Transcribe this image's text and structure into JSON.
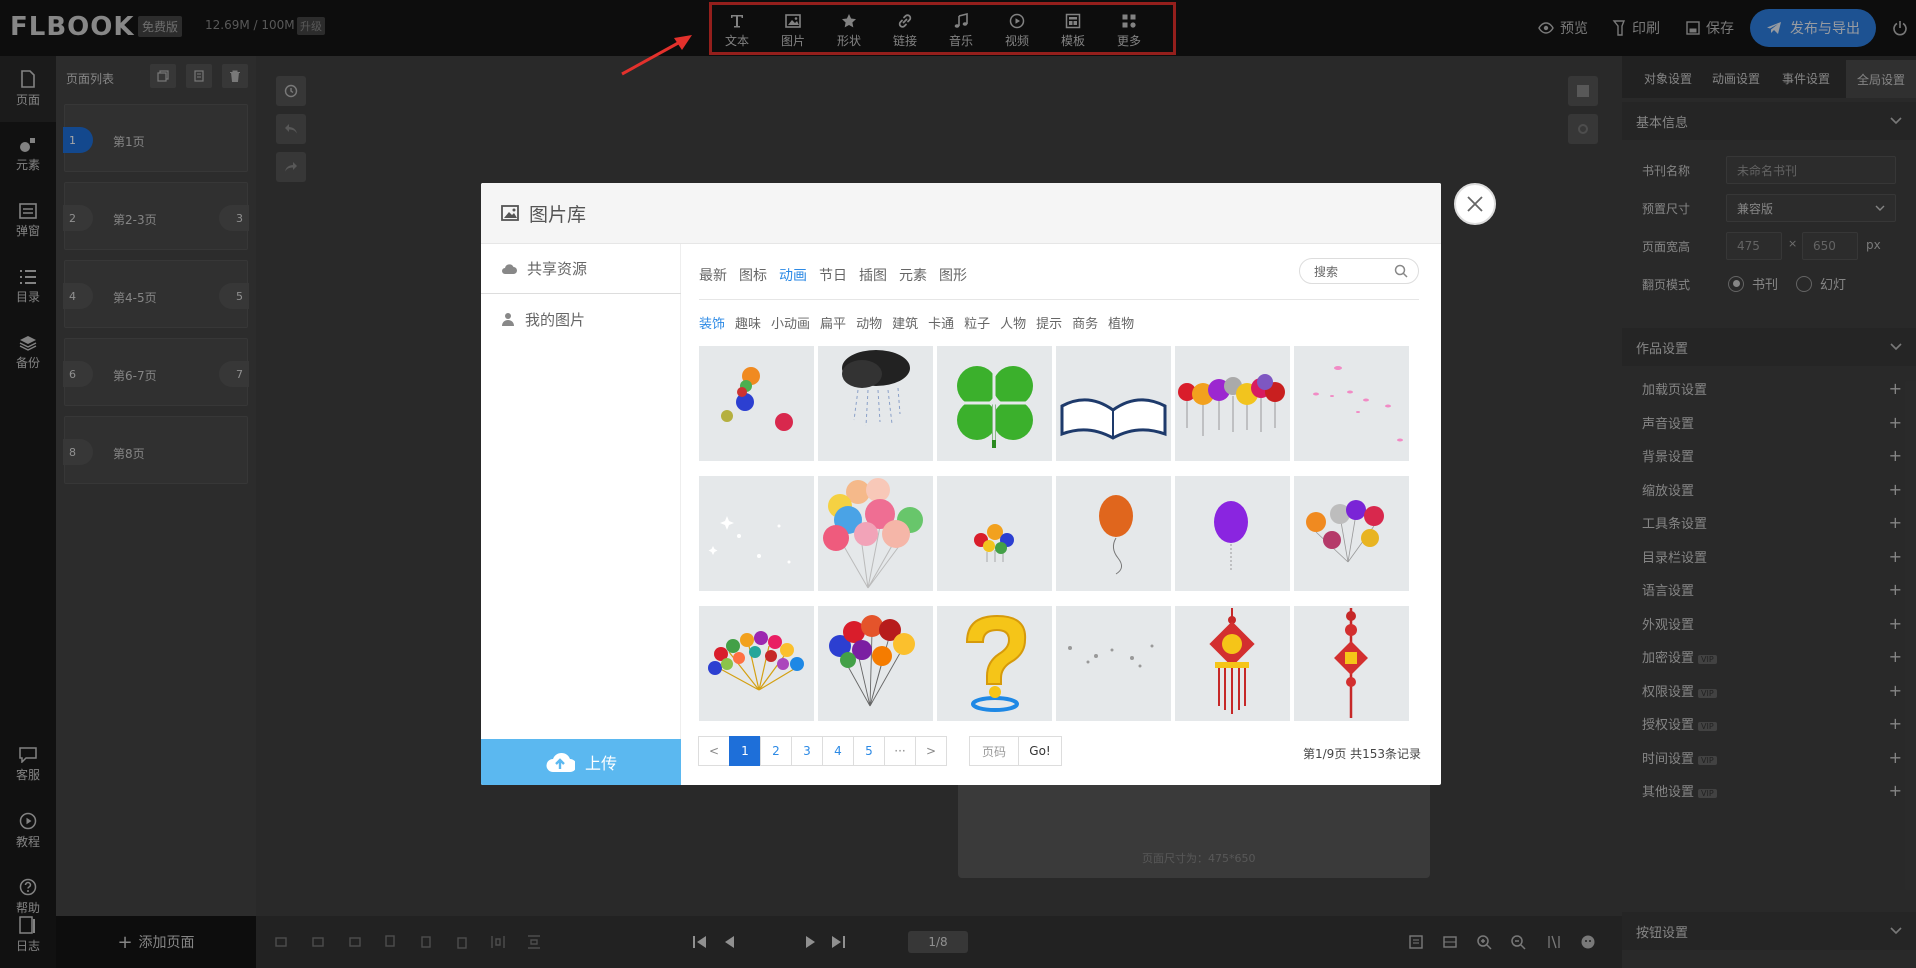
{
  "app": {
    "logo": "FLBOOK",
    "edition_badge": "免费版",
    "storage": "12.69M / 100M",
    "upgrade_badge": "升级"
  },
  "toolbar": {
    "tools": [
      {
        "label": "文本",
        "icon": "text-icon"
      },
      {
        "label": "图片",
        "icon": "image-icon"
      },
      {
        "label": "形状",
        "icon": "star-icon"
      },
      {
        "label": "链接",
        "icon": "link-icon"
      },
      {
        "label": "音乐",
        "icon": "music-icon"
      },
      {
        "label": "视频",
        "icon": "video-icon"
      },
      {
        "label": "模板",
        "icon": "template-icon"
      },
      {
        "label": "更多",
        "icon": "more-icon"
      }
    ],
    "preview": "预览",
    "print": "印刷",
    "save": "保存",
    "publish": "发布与导出"
  },
  "left_nav": {
    "items": [
      {
        "label": "页面",
        "icon": "page-icon"
      },
      {
        "label": "元素",
        "icon": "element-icon"
      },
      {
        "label": "弹窗",
        "icon": "popup-icon"
      },
      {
        "label": "目录",
        "icon": "toc-icon"
      },
      {
        "label": "备份",
        "icon": "backup-icon"
      }
    ],
    "bottom_items": [
      {
        "label": "客服",
        "icon": "chat-icon"
      },
      {
        "label": "教程",
        "icon": "play-icon"
      },
      {
        "label": "帮助",
        "icon": "help-icon"
      },
      {
        "label": "日志",
        "icon": "log-icon"
      }
    ]
  },
  "page_list": {
    "title": "页面列表",
    "pages": [
      {
        "left_num": "1",
        "label": "第1页",
        "right_num": "",
        "active": true
      },
      {
        "left_num": "2",
        "label": "第2-3页",
        "right_num": "3",
        "active": false
      },
      {
        "left_num": "4",
        "label": "第4-5页",
        "right_num": "5",
        "active": false
      },
      {
        "left_num": "6",
        "label": "第6-7页",
        "right_num": "7",
        "active": false
      },
      {
        "left_num": "8",
        "label": "第8页",
        "right_num": "",
        "active": false
      }
    ],
    "add_page": "添加页面"
  },
  "canvas": {
    "page_size": "页面尺寸为：475*650",
    "pager": "1/8"
  },
  "right_panel": {
    "tabs": [
      "对象设置",
      "动画设置",
      "事件设置",
      "全局设置"
    ],
    "active_tab": "全局设置",
    "basic_info": {
      "title": "基本信息",
      "book_name_label": "书刊名称",
      "book_name_placeholder": "未命名书刊",
      "preset_label": "预置尺寸",
      "preset_value": "兼容版",
      "size_label": "页面宽高",
      "width": "475",
      "times": "×",
      "height": "650",
      "unit": "px",
      "flip_label": "翻页模式",
      "flip_book": "书刊",
      "flip_slide": "幻灯"
    },
    "work_settings": "作品设置",
    "items": [
      {
        "label": "加载页设置",
        "vip": ""
      },
      {
        "label": "声音设置",
        "vip": ""
      },
      {
        "label": "背景设置",
        "vip": ""
      },
      {
        "label": "缩放设置",
        "vip": ""
      },
      {
        "label": "工具条设置",
        "vip": ""
      },
      {
        "label": "目录栏设置",
        "vip": ""
      },
      {
        "label": "语言设置",
        "vip": ""
      },
      {
        "label": "外观设置",
        "vip": ""
      },
      {
        "label": "加密设置",
        "vip": "VIP"
      },
      {
        "label": "权限设置",
        "vip": "VIP"
      },
      {
        "label": "授权设置",
        "vip": "VIP"
      },
      {
        "label": "时间设置",
        "vip": "VIP"
      },
      {
        "label": "其他设置",
        "vip": "VIP"
      }
    ],
    "button_settings": "按钮设置"
  },
  "modal": {
    "title": "图片库",
    "nav": [
      {
        "label": "共享资源",
        "icon": "cloud-icon"
      },
      {
        "label": "我的图片",
        "icon": "user-icon"
      }
    ],
    "upload": "上传",
    "categories": [
      "最新",
      "图标",
      "动画",
      "节日",
      "插图",
      "元素",
      "图形"
    ],
    "active_category": "动画",
    "search_placeholder": "搜索",
    "subcategories": [
      "装饰",
      "趣味",
      "小动画",
      "扁平",
      "动物",
      "建筑",
      "卡通",
      "粒子",
      "人物",
      "提示",
      "商务",
      "植物"
    ],
    "active_subcategory": "装饰",
    "thumbnails": [
      "balloons-small",
      "storm-cloud",
      "four-leaf-clover",
      "open-book",
      "balloon-row",
      "pink-petals",
      "sparkles",
      "balloon-bunch",
      "tiny-balloons",
      "orange-balloon",
      "purple-balloon",
      "balloon-cluster",
      "colorful-balloon-fan",
      "balloon-bouquet",
      "question-mark",
      "sparkle-dots",
      "chinese-knot-lantern",
      "chinese-knot"
    ],
    "pagination": {
      "prev": "<",
      "pages": [
        "1",
        "2",
        "3",
        "4",
        "5",
        "···"
      ],
      "next": ">",
      "page_input_placeholder": "页码",
      "go": "Go!",
      "info": "第1/9页 共153条记录"
    }
  },
  "colors": {
    "accent": "#1e6fd9",
    "publish": "#2d7fe0",
    "highlight_box": "#e3312c",
    "upload": "#5bb8f0"
  }
}
